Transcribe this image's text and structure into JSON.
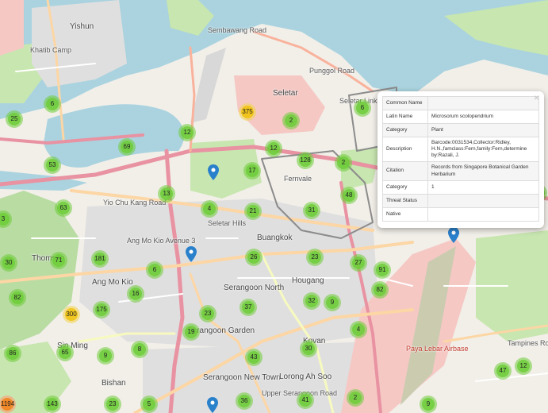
{
  "places": [
    {
      "id": "yishun",
      "text": "Yishun",
      "size": "big"
    },
    {
      "id": "khatib",
      "text": "Khatib Camp",
      "size": "small"
    },
    {
      "id": "seletar",
      "text": "Seletar",
      "size": "big"
    },
    {
      "id": "seletar-link",
      "text": "Seletar Link",
      "size": "small"
    },
    {
      "id": "thomson",
      "text": "Thomson",
      "size": "big"
    },
    {
      "id": "angmokio",
      "text": "Ang Mo Kio",
      "size": "big"
    },
    {
      "id": "buangkok",
      "text": "Buangkok",
      "size": "big"
    },
    {
      "id": "serangoon-north",
      "text": "Serangoon North",
      "size": "big"
    },
    {
      "id": "hougang",
      "text": "Hougang",
      "size": "big"
    },
    {
      "id": "serangoon-garden",
      "text": "Serangoon Garden",
      "size": "big"
    },
    {
      "id": "sin-ming",
      "text": "Sin Ming",
      "size": "big"
    },
    {
      "id": "bishan",
      "text": "Bishan",
      "size": "big"
    },
    {
      "id": "serangoon-new-town",
      "text": "Serangoon New Town",
      "size": "big"
    },
    {
      "id": "lorong-ah-soo",
      "text": "Lorong Ah Soo",
      "size": "big"
    },
    {
      "id": "kovan",
      "text": "Kovan",
      "size": "big"
    },
    {
      "id": "fernvale",
      "text": "Fernvale",
      "size": "small"
    },
    {
      "id": "paya-lebar",
      "text": "Paya Lebar Airbase",
      "size": "air"
    },
    {
      "id": "sembawang-rd",
      "text": "Sembawang Road",
      "size": "small"
    },
    {
      "id": "yio-chu-kang",
      "text": "Yio Chu Kang Road",
      "size": "small"
    },
    {
      "id": "ang-mo-kio-ave",
      "text": "Ang Mo Kio Avenue 3",
      "size": "small"
    },
    {
      "id": "tampines",
      "text": "Tampines Road",
      "size": "small"
    },
    {
      "id": "seletar-hills",
      "text": "Seletar Hills",
      "size": "small"
    },
    {
      "id": "kovan-rd",
      "text": "Upper Serangoon Road",
      "size": "small"
    },
    {
      "id": "punggol-rd",
      "text": "Punggol Road",
      "size": "small"
    }
  ],
  "clusters": [
    {
      "count": "25",
      "tier": "small"
    },
    {
      "count": "6",
      "tier": "small"
    },
    {
      "count": "12",
      "tier": "small"
    },
    {
      "count": "375",
      "tier": "med"
    },
    {
      "count": "2",
      "tier": "small"
    },
    {
      "count": "6",
      "tier": "small"
    },
    {
      "count": "69",
      "tier": "small"
    },
    {
      "count": "53",
      "tier": "small"
    },
    {
      "count": "12",
      "tier": "small"
    },
    {
      "count": "17",
      "tier": "small"
    },
    {
      "count": "128",
      "tier": "small"
    },
    {
      "count": "2",
      "tier": "small"
    },
    {
      "count": "13",
      "tier": "small"
    },
    {
      "count": "48",
      "tier": "small"
    },
    {
      "count": "16",
      "tier": "small"
    },
    {
      "count": "63",
      "tier": "small"
    },
    {
      "count": "4",
      "tier": "small"
    },
    {
      "count": "21",
      "tier": "small"
    },
    {
      "count": "31",
      "tier": "small"
    },
    {
      "count": "3",
      "tier": "small"
    },
    {
      "count": "30",
      "tier": "small"
    },
    {
      "count": "71",
      "tier": "small"
    },
    {
      "count": "181",
      "tier": "small"
    },
    {
      "count": "6",
      "tier": "small"
    },
    {
      "count": "26",
      "tier": "small"
    },
    {
      "count": "23",
      "tier": "small"
    },
    {
      "count": "27",
      "tier": "small"
    },
    {
      "count": "91",
      "tier": "small"
    },
    {
      "count": "82",
      "tier": "small"
    },
    {
      "count": "16",
      "tier": "small"
    },
    {
      "count": "32",
      "tier": "small"
    },
    {
      "count": "9",
      "tier": "small"
    },
    {
      "count": "82",
      "tier": "small"
    },
    {
      "count": "175",
      "tier": "small"
    },
    {
      "count": "37",
      "tier": "small"
    },
    {
      "count": "300",
      "tier": "med"
    },
    {
      "count": "23",
      "tier": "small"
    },
    {
      "count": "19",
      "tier": "small"
    },
    {
      "count": "4",
      "tier": "small"
    },
    {
      "count": "86",
      "tier": "small"
    },
    {
      "count": "65",
      "tier": "small"
    },
    {
      "count": "9",
      "tier": "small"
    },
    {
      "count": "8",
      "tier": "small"
    },
    {
      "count": "30",
      "tier": "small"
    },
    {
      "count": "43",
      "tier": "small"
    },
    {
      "count": "47",
      "tier": "small"
    },
    {
      "count": "12",
      "tier": "small"
    },
    {
      "count": "1194",
      "tier": "large"
    },
    {
      "count": "23",
      "tier": "small"
    },
    {
      "count": "36",
      "tier": "small"
    },
    {
      "count": "41",
      "tier": "small"
    },
    {
      "count": "2",
      "tier": "small"
    },
    {
      "count": "9",
      "tier": "small"
    },
    {
      "count": "5",
      "tier": "small"
    },
    {
      "count": "143",
      "tier": "small"
    }
  ],
  "popup": {
    "close": "×",
    "rows": [
      {
        "label": "Common Name",
        "value": ""
      },
      {
        "label": "Latin Name",
        "value": "Microsorum scolopendrium"
      },
      {
        "label": "Category",
        "value": "Plant"
      },
      {
        "label": "Description",
        "value": "Barcode:0031534,Collector:Ridley, H.N.,famclass:Fern,family:Fern,determine by:Razali, J."
      },
      {
        "label": "Citation",
        "value": "Records from Singapore Botanical Garden Herbarium"
      },
      {
        "label": "Category",
        "value": "1"
      },
      {
        "label": "Threat Status",
        "value": ""
      },
      {
        "label": "Native",
        "value": ""
      }
    ]
  },
  "colors": {
    "land": "#f2efe9",
    "water": "#aad3df",
    "park": "#c8e6b0",
    "forest": "#a8d89a",
    "residential": "#e0dfdf",
    "military": "#f5c8c4",
    "motorway": "#e892a2",
    "trunk": "#f9b29c",
    "primary": "#fcd6a4",
    "secondary": "#f7fabf",
    "rail": "#888888",
    "pin": "#2a81cb"
  }
}
